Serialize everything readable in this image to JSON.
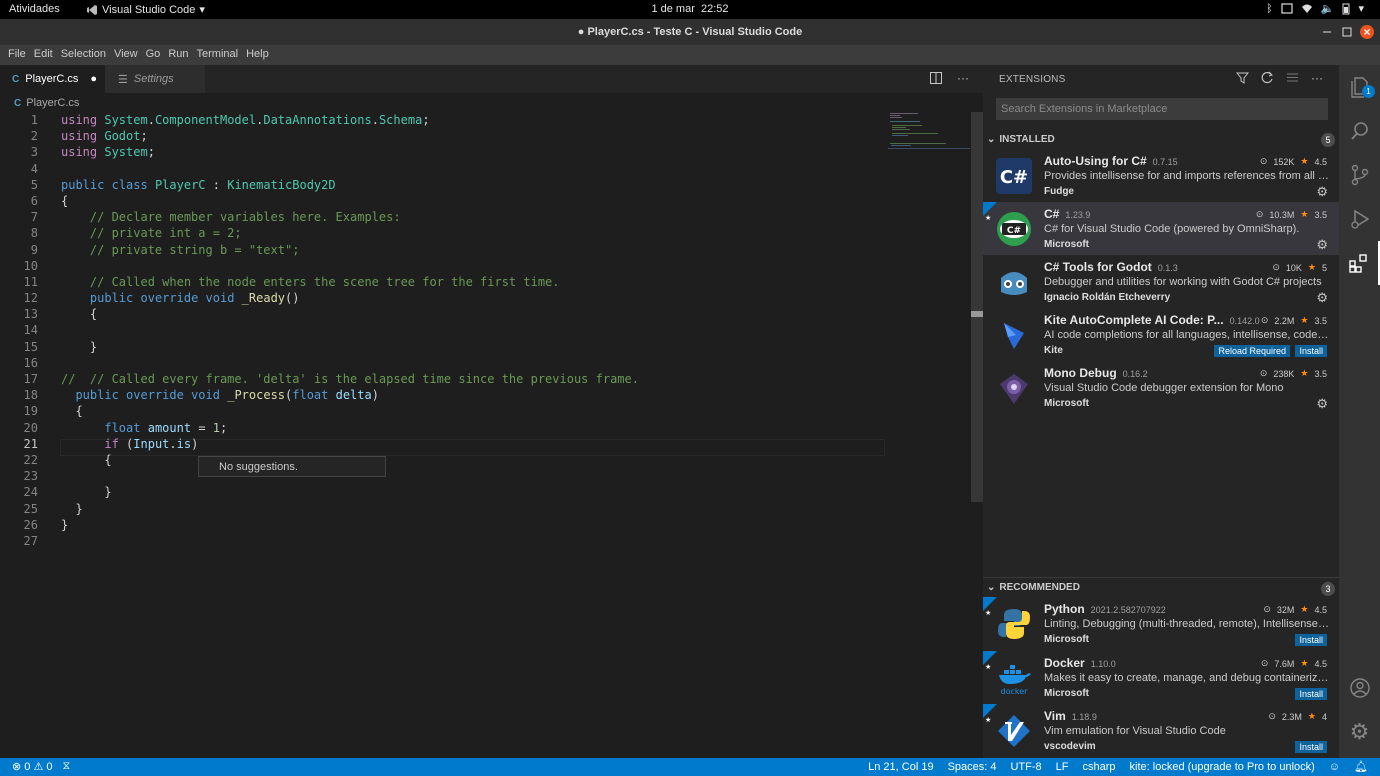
{
  "system_bar": {
    "activities": "Atividades",
    "app_name": "Visual Studio Code",
    "date": "1 de mar",
    "time": "22:52"
  },
  "window": {
    "title": "● PlayerC.cs - Teste C - Visual Studio Code"
  },
  "menu": [
    "File",
    "Edit",
    "Selection",
    "View",
    "Go",
    "Run",
    "Terminal",
    "Help"
  ],
  "tabs": {
    "active": "PlayerC.cs",
    "settings": "Settings"
  },
  "breadcrumb": "PlayerC.cs",
  "editor": {
    "current_line": "21",
    "suggestion": "No suggestions."
  },
  "sidebar": {
    "header": "EXTENSIONS",
    "search_placeholder": "Search Extensions in Marketplace",
    "installed": {
      "label": "INSTALLED",
      "count": "5",
      "items": [
        {
          "name": "Auto-Using for C#",
          "version": "0.7.15",
          "downloads": "152K",
          "rating": "4.5",
          "description": "Provides intellisense for and imports references from all available so...",
          "publisher": "Fudge"
        },
        {
          "name": "C#",
          "version": "1.23.9",
          "downloads": "10.3M",
          "rating": "3.5",
          "description": "C# for Visual Studio Code (powered by OmniSharp).",
          "publisher": "Microsoft"
        },
        {
          "name": "C# Tools for Godot",
          "version": "0.1.3",
          "downloads": "10K",
          "rating": "5",
          "description": "Debugger and utilities for working with Godot C# projects",
          "publisher": "Ignacio Roldán Etcheverry"
        },
        {
          "name": "Kite AutoComplete AI Code: P...",
          "version": "0.142.0",
          "downloads": "2.2M",
          "rating": "3.5",
          "description": "AI code completions for all languages, intellisense, code snippets, co...",
          "publisher": "Kite",
          "buttons": [
            "Reload Required",
            "Install"
          ]
        },
        {
          "name": "Mono Debug",
          "version": "0.16.2",
          "downloads": "238K",
          "rating": "3.5",
          "description": "Visual Studio Code debugger extension for Mono",
          "publisher": "Microsoft"
        }
      ]
    },
    "recommended": {
      "label": "RECOMMENDED",
      "count": "3",
      "items": [
        {
          "name": "Python",
          "version": "2021.2.582707922",
          "downloads": "32M",
          "rating": "4.5",
          "description": "Linting, Debugging (multi-threaded, remote), Intellisense, Jupyter...",
          "publisher": "Microsoft",
          "button": "Install"
        },
        {
          "name": "Docker",
          "version": "1.10.0",
          "downloads": "7.6M",
          "rating": "4.5",
          "description": "Makes it easy to create, manage, and debug containerized applications.",
          "publisher": "Microsoft",
          "button": "Install"
        },
        {
          "name": "Vim",
          "version": "1.18.9",
          "downloads": "2.3M",
          "rating": "4",
          "description": "Vim emulation for Visual Studio Code",
          "publisher": "vscodevim",
          "button": "Install"
        }
      ]
    }
  },
  "statusbar": {
    "errors": "0",
    "warnings": "0",
    "position": "Ln 21, Col 19",
    "spaces": "Spaces: 4",
    "encoding": "UTF-8",
    "eol": "LF",
    "language": "csharp",
    "kite": "kite: locked (upgrade to Pro to unlock)"
  },
  "activity_badge": "1",
  "colors": {
    "accent": "#007acc",
    "editor_bg": "#1e1e1e",
    "sidebar_bg": "#252526"
  }
}
